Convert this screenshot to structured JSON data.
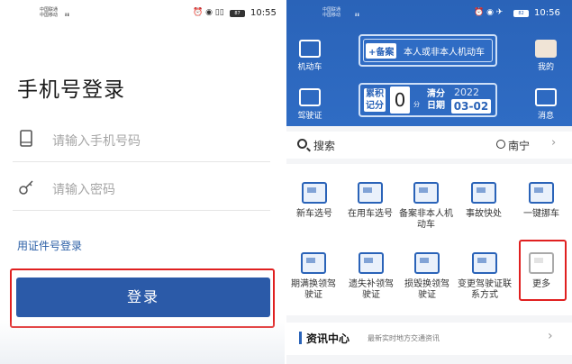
{
  "left_screen": {
    "status": {
      "carrier_top": "中国联通",
      "carrier_bottom": "中国移动",
      "signal": "ᵢₗₗ ᵢₗₗ",
      "icons": "⏰ ◉ ▯▯",
      "battery": "87",
      "time": "10:55"
    },
    "title": "手机号登录",
    "phone_placeholder": "请输入手机号码",
    "password_placeholder": "请输入密码",
    "cert_login": "用证件号登录",
    "login_button": "登录"
  },
  "right_screen": {
    "status": {
      "carrier_top": "中国联通",
      "carrier_bottom": "中国移动",
      "signal": "ᵢₗₗ ᵢₗₗ",
      "icons": "⏰ ◉ ✈",
      "battery": "82",
      "time": "10:56"
    },
    "header": {
      "vehicle_label": "机动车",
      "license_label": "驾驶证",
      "mine_label": "我的",
      "message_label": "消息",
      "plate_tag": "+备案",
      "plate_text": "本人或非本人机动车",
      "score_label": "累积记分",
      "score_value": "0",
      "score_unit": "分",
      "clear_label": "清分日期",
      "clear_year": "2022",
      "clear_date": "03-02"
    },
    "search": {
      "label": "搜索",
      "location": "南宁",
      "chevron": "›"
    },
    "services": [
      {
        "label": "新车选号"
      },
      {
        "label": "在用车选号"
      },
      {
        "label": "备案非本人机动车"
      },
      {
        "label": "事故快处"
      },
      {
        "label": "一键挪车"
      },
      {
        "label": "期满换领驾驶证"
      },
      {
        "label": "遗失补领驾驶证"
      },
      {
        "label": "损毁换领驾驶证"
      },
      {
        "label": "变更驾驶证联系方式"
      },
      {
        "label": "更多"
      }
    ],
    "news": {
      "title": "资讯中心",
      "subtitle": "最新实时地方交通资讯",
      "chevron": "›"
    }
  },
  "colors": {
    "brand_blue": "#2b5aa8",
    "highlight_red": "#e02020"
  }
}
